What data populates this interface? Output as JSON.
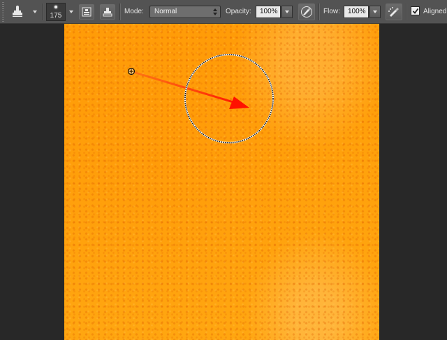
{
  "options_bar": {
    "tool_icon": "clone-stamp-icon",
    "brush_size": "175",
    "clone_source_icon": "clone-source-panel-icon",
    "pattern_icon": "stamp-pattern-icon",
    "mode_label": "Mode:",
    "mode_value": "Normal",
    "opacity_label": "Opacity:",
    "opacity_value": "100%",
    "pressure_opacity_icon": "pressure-opacity-icon",
    "flow_label": "Flow:",
    "flow_value": "100%",
    "airbrush_icon": "airbrush-icon",
    "aligned_label": "Aligned",
    "aligned_checked": true
  },
  "document": {
    "content": "orange-peel-texture",
    "annotation_color": "#ff1a00",
    "sample_point_icon": "clone-sample-crosshair-icon",
    "brush_cursor_icon": "brush-circle-cursor"
  }
}
